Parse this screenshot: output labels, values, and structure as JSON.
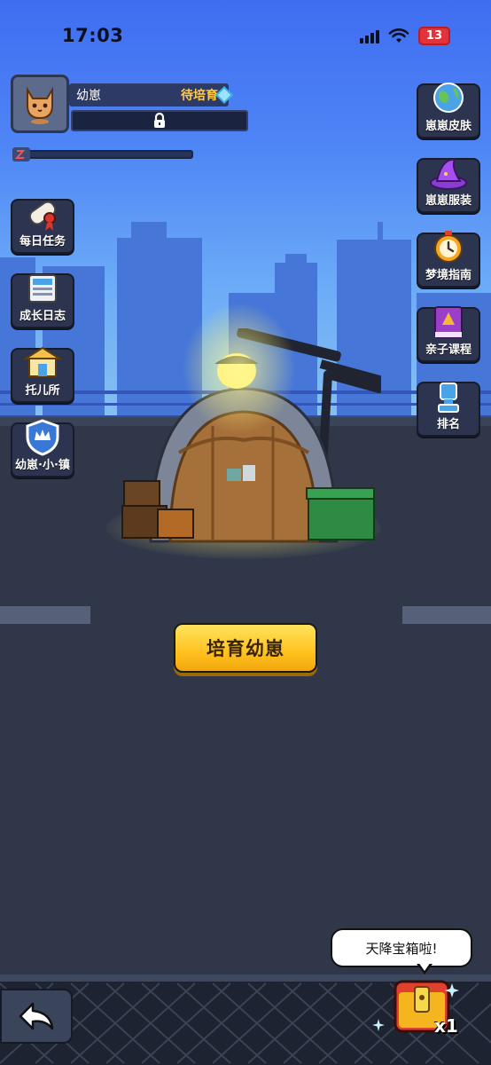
{
  "status_bar": {
    "time": "17:03",
    "battery": "13"
  },
  "profile": {
    "name": "幼崽",
    "status": "待培育"
  },
  "left_menu": [
    {
      "label": "每日任务",
      "icon": "scroll-icon"
    },
    {
      "label": "成长日志",
      "icon": "newspaper-icon"
    },
    {
      "label": "托儿所",
      "icon": "house-icon"
    },
    {
      "label": "幼崽·小·镇",
      "icon": "shield-crown-icon"
    }
  ],
  "right_menu": [
    {
      "label": "崽崽皮肤",
      "icon": "planet-icon"
    },
    {
      "label": "崽崽服装",
      "icon": "wizard-hat-icon"
    },
    {
      "label": "梦境指南",
      "icon": "alarm-clock-icon"
    },
    {
      "label": "亲子课程",
      "icon": "book-icon"
    },
    {
      "label": "排名",
      "icon": "trophy-icon"
    }
  ],
  "main_button": {
    "label": "培育幼崽"
  },
  "bubble": {
    "text": "天降宝箱啦!"
  },
  "chest": {
    "count": "x1"
  },
  "colors": {
    "accent": "#ffc21f",
    "sky": "#4f86f6",
    "road": "#2f3749"
  }
}
